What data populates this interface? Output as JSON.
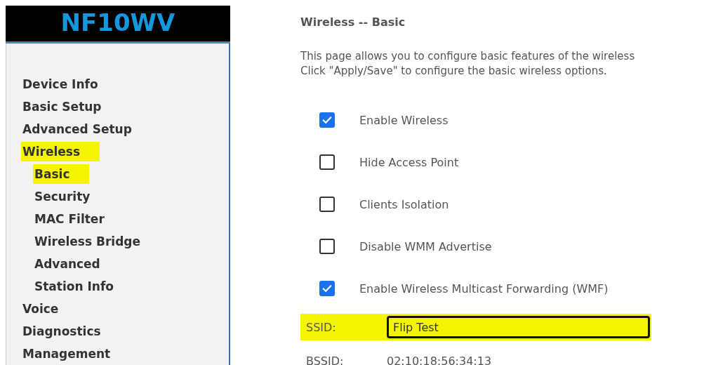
{
  "logo": "NF10WV",
  "sidebar": {
    "items": [
      {
        "label": "Device Info",
        "highlighted": false
      },
      {
        "label": "Basic Setup",
        "highlighted": false
      },
      {
        "label": "Advanced Setup",
        "highlighted": false
      },
      {
        "label": "Wireless",
        "highlighted": true,
        "children": [
          {
            "label": "Basic",
            "highlighted": true
          },
          {
            "label": "Security",
            "highlighted": false
          },
          {
            "label": "MAC Filter",
            "highlighted": false
          },
          {
            "label": "Wireless Bridge",
            "highlighted": false
          },
          {
            "label": "Advanced",
            "highlighted": false
          },
          {
            "label": "Station Info",
            "highlighted": false
          }
        ]
      },
      {
        "label": "Voice",
        "highlighted": false
      },
      {
        "label": "Diagnostics",
        "highlighted": false
      },
      {
        "label": "Management",
        "highlighted": false
      }
    ]
  },
  "page": {
    "title": "Wireless -- Basic",
    "description": [
      "This page allows you to configure basic features of the wireless",
      "Click \"Apply/Save\" to configure the basic wireless options."
    ],
    "options": [
      {
        "label": "Enable Wireless",
        "checked": true
      },
      {
        "label": "Hide Access Point",
        "checked": false
      },
      {
        "label": "Clients Isolation",
        "checked": false
      },
      {
        "label": "Disable WMM Advertise",
        "checked": false
      },
      {
        "label": "Enable Wireless Multicast Forwarding (WMF)",
        "checked": true
      }
    ],
    "ssid": {
      "label": "SSID:",
      "value": "Flip Test",
      "highlighted": true
    },
    "bssid": {
      "label": "BSSID:",
      "value": "02:10:18:56:34:13"
    }
  }
}
